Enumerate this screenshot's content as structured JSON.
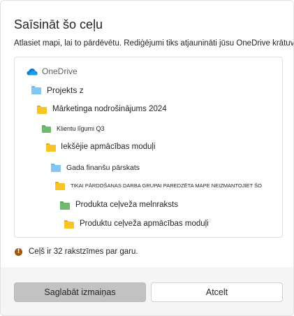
{
  "dialog": {
    "title": "Saīsināt šo ceļu",
    "subtitle": "Atlasiet mapi, lai to pārdēvētu. Rediģējumi tiks atjaunināti jūsu OneDrive krātuvē."
  },
  "tree": {
    "root_label": "OneDrive",
    "items": [
      {
        "label": "Projekts z",
        "color": "#82c7f4"
      },
      {
        "label": "Mārketinga nodrošinājums 2024",
        "color": "#f7c325"
      },
      {
        "label": "Klientu līgumi Q3",
        "color": "#6fba6f"
      },
      {
        "label": "Iekšējie apmācības moduļi",
        "color": "#f7c325"
      },
      {
        "label": "Gada finanšu pārskats",
        "color": "#82c7f4"
      },
      {
        "label": "TIKAI PĀRDOŠANAS DARBA GRUPAI PAREDZĒTA MAPE NEIZMANTOJIET ŠO",
        "color": "#f7c325"
      },
      {
        "label": "Produkta ceļveža melnraksts",
        "color": "#6fba6f"
      },
      {
        "label": "Produktu ceļveža apmācības moduļi",
        "color": "#f7c325"
      }
    ]
  },
  "warning": {
    "icon": "warning-circle-icon",
    "text": "Ceļš ir 32 rakstzīmes par garu."
  },
  "footer": {
    "save_label": "Saglabāt izmaiņas",
    "cancel_label": "Atcelt"
  },
  "colors": {
    "onedrive_blue": "#0f78d4",
    "warning": "#a4560b",
    "primary_disabled": "#c2c2c2"
  }
}
